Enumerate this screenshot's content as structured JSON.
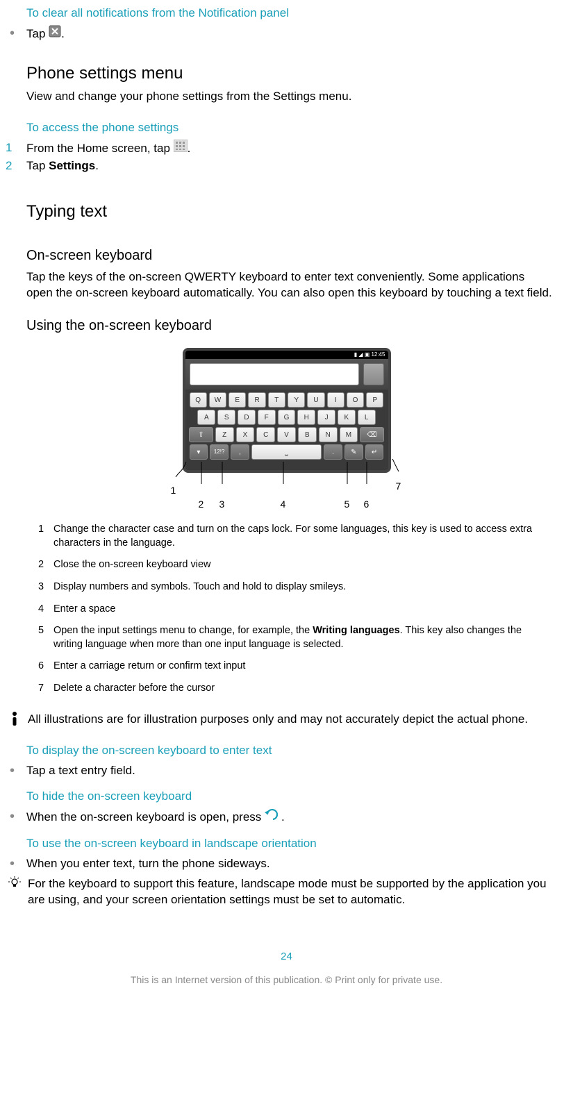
{
  "clearNotif": {
    "heading": "To clear all notifications from the Notification panel",
    "tap_prefix": "Tap ",
    "tap_suffix": "."
  },
  "phoneSettings": {
    "heading": "Phone settings menu",
    "desc": "View and change your phone settings from the Settings menu.",
    "access_heading": "To access the phone settings",
    "step1_num": "1",
    "step1_prefix": "From the Home screen, tap ",
    "step1_suffix": ".",
    "step2_num": "2",
    "step2_prefix": "Tap ",
    "step2_bold": "Settings",
    "step2_suffix": "."
  },
  "typing": {
    "heading": "Typing text",
    "osk_heading": "On-screen keyboard",
    "osk_desc": "Tap the keys of the on-screen QWERTY keyboard to enter text conveniently. Some applications open the on-screen keyboard automatically. You can also open this keyboard by touching a text field.",
    "using_heading": "Using the on-screen keyboard"
  },
  "kb": {
    "status_time": "12:45",
    "row1": [
      "Q",
      "W",
      "E",
      "R",
      "T",
      "Y",
      "U",
      "I",
      "O",
      "P"
    ],
    "row2": [
      "A",
      "S",
      "D",
      "F",
      "G",
      "H",
      "J",
      "K",
      "L"
    ],
    "row3_mid": [
      "Z",
      "X",
      "C",
      "V",
      "B",
      "N",
      "M"
    ],
    "row4_sym": "12!?",
    "callouts": {
      "c1": "1",
      "c2": "2",
      "c3": "3",
      "c4": "4",
      "c5": "5",
      "c6": "6",
      "c7": "7"
    }
  },
  "legend": [
    {
      "n": "1",
      "t": "Change the character case and turn on the caps lock. For some languages, this key is used to access extra characters in the language."
    },
    {
      "n": "2",
      "t": "Close the on-screen keyboard view"
    },
    {
      "n": "3",
      "t": "Display numbers and symbols. Touch and hold to display smileys."
    },
    {
      "n": "4",
      "t": "Enter a space"
    },
    {
      "n": "5",
      "t_pre": "Open the input settings menu to change, for example, the ",
      "t_bold": "Writing languages",
      "t_post": ". This key also changes the writing language when more than one input language is selected."
    },
    {
      "n": "6",
      "t": "Enter a carriage return or confirm text input"
    },
    {
      "n": "7",
      "t": "Delete a character before the cursor"
    }
  ],
  "warn": "All illustrations are for illustration purposes only and may not accurately depict the actual phone.",
  "display": {
    "heading": "To display the on-screen keyboard to enter text",
    "text": "Tap a text entry field."
  },
  "hide": {
    "heading": "To hide the on-screen keyboard",
    "prefix": "When the on-screen keyboard is open, press ",
    "suffix": "."
  },
  "landscape": {
    "heading": "To use the on-screen keyboard in landscape orientation",
    "text": "When you enter text, turn the phone sideways."
  },
  "tip": "For the keyboard to support this feature, landscape mode must be supported by the application you are using, and your screen orientation settings must be set to automatic.",
  "pageNum": "24",
  "footer": "This is an Internet version of this publication. © Print only for private use."
}
